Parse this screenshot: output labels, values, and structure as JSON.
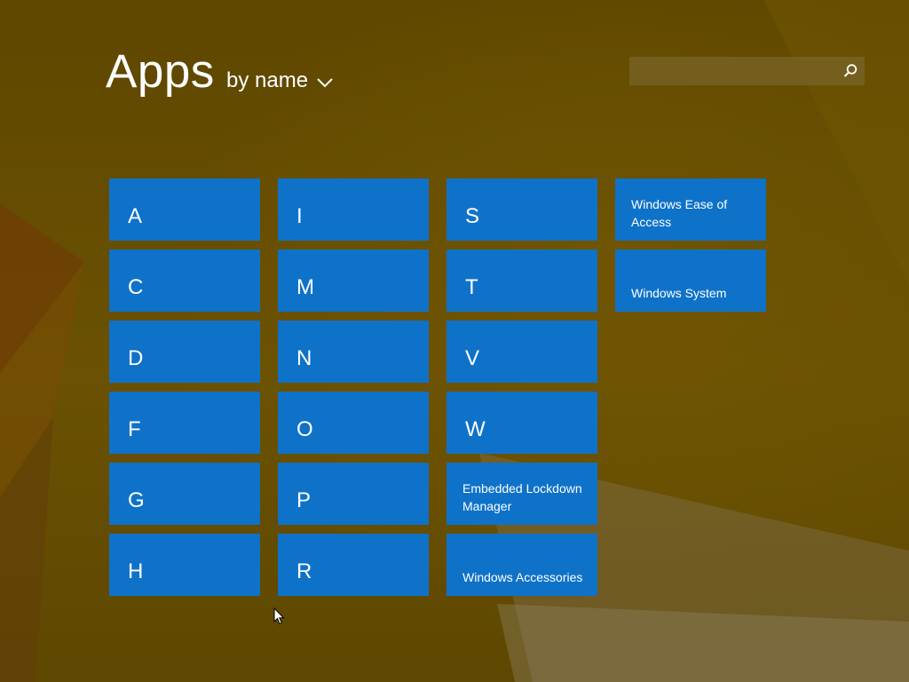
{
  "header": {
    "title": "Apps",
    "sort_label": "by name",
    "sort_icon": "chevron-down-icon"
  },
  "search": {
    "placeholder": "",
    "value": "",
    "icon": "search-icon"
  },
  "colors": {
    "tile": "#0f72c9",
    "text": "#ffffff",
    "background": "#5f4700"
  },
  "tiles": [
    {
      "type": "letter",
      "label": "A"
    },
    {
      "type": "letter",
      "label": "C"
    },
    {
      "type": "letter",
      "label": "D"
    },
    {
      "type": "letter",
      "label": "F"
    },
    {
      "type": "letter",
      "label": "G"
    },
    {
      "type": "letter",
      "label": "H"
    },
    {
      "type": "letter",
      "label": "I"
    },
    {
      "type": "letter",
      "label": "M"
    },
    {
      "type": "letter",
      "label": "N"
    },
    {
      "type": "letter",
      "label": "O"
    },
    {
      "type": "letter",
      "label": "P"
    },
    {
      "type": "letter",
      "label": "R"
    },
    {
      "type": "letter",
      "label": "S"
    },
    {
      "type": "letter",
      "label": "T"
    },
    {
      "type": "letter",
      "label": "V"
    },
    {
      "type": "letter",
      "label": "W"
    },
    {
      "type": "group",
      "label": "Embedded Lockdown Manager"
    },
    {
      "type": "group",
      "label": "Windows Accessories"
    },
    {
      "type": "group",
      "label": "Windows Ease of Access"
    },
    {
      "type": "group",
      "label": "Windows System"
    }
  ]
}
